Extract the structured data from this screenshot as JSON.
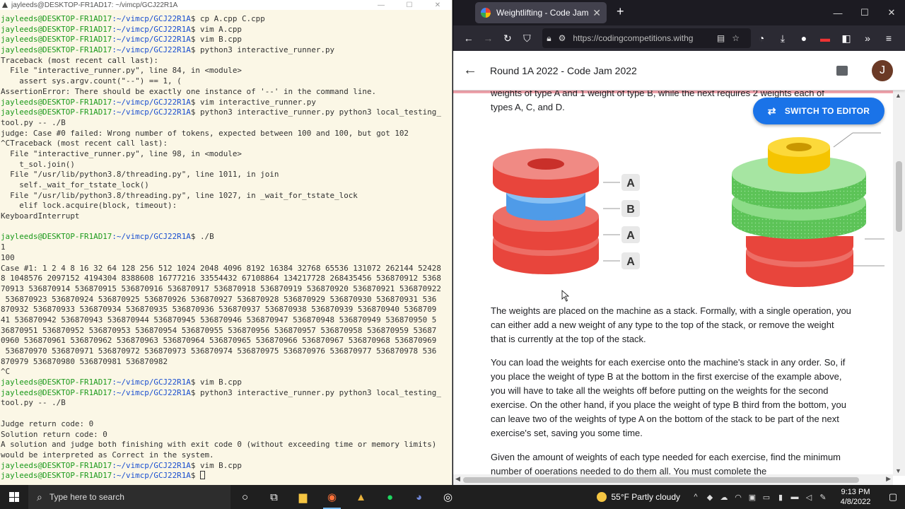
{
  "terminal": {
    "title": "jayleeds@DESKTOP-FR1AD17: ~/vimcp/GCJ22R1A",
    "lines": [
      {
        "u": "jayleeds@DESKTOP-FR1AD17",
        "p": ":~/vimcp/GCJ22R1A",
        "t": "$ cp A.cpp C.cpp"
      },
      {
        "u": "jayleeds@DESKTOP-FR1AD17",
        "p": ":~/vimcp/GCJ22R1A",
        "t": "$ vim A.cpp"
      },
      {
        "u": "jayleeds@DESKTOP-FR1AD17",
        "p": ":~/vimcp/GCJ22R1A",
        "t": "$ vim B.cpp"
      },
      {
        "u": "jayleeds@DESKTOP-FR1AD17",
        "p": ":~/vimcp/GCJ22R1A",
        "t": "$ python3 interactive_runner.py"
      },
      {
        "t": "Traceback (most recent call last):"
      },
      {
        "t": "  File \"interactive_runner.py\", line 84, in <module>"
      },
      {
        "t": "    assert sys.argv.count(\"--\") == 1, ("
      },
      {
        "t": "AssertionError: There should be exactly one instance of '--' in the command line."
      },
      {
        "u": "jayleeds@DESKTOP-FR1AD17",
        "p": ":~/vimcp/GCJ22R1A",
        "t": "$ vim interactive_runner.py"
      },
      {
        "u": "jayleeds@DESKTOP-FR1AD17",
        "p": ":~/vimcp/GCJ22R1A",
        "t": "$ python3 interactive_runner.py python3 local_testing_"
      },
      {
        "t": "tool.py -- ./B"
      },
      {
        "t": "judge: Case #0 failed: Wrong number of tokens, expected between 100 and 100, but got 102"
      },
      {
        "t": "^CTraceback (most recent call last):"
      },
      {
        "t": "  File \"interactive_runner.py\", line 98, in <module>"
      },
      {
        "t": "    t_sol.join()"
      },
      {
        "t": "  File \"/usr/lib/python3.8/threading.py\", line 1011, in join"
      },
      {
        "t": "    self._wait_for_tstate_lock()"
      },
      {
        "t": "  File \"/usr/lib/python3.8/threading.py\", line 1027, in _wait_for_tstate_lock"
      },
      {
        "t": "    elif lock.acquire(block, timeout):"
      },
      {
        "t": "KeyboardInterrupt"
      },
      {
        "t": ""
      },
      {
        "u": "jayleeds@DESKTOP-FR1AD17",
        "p": ":~/vimcp/GCJ22R1A",
        "t": "$ ./B"
      },
      {
        "t": "1"
      },
      {
        "t": "100"
      },
      {
        "t": "Case #1: 1 2 4 8 16 32 64 128 256 512 1024 2048 4096 8192 16384 32768 65536 131072 262144 52428"
      },
      {
        "t": "8 1048576 2097152 4194304 8388608 16777216 33554432 67108864 134217728 268435456 536870912 5368"
      },
      {
        "t": "70913 536870914 536870915 536870916 536870917 536870918 536870919 536870920 536870921 536870922"
      },
      {
        "t": " 536870923 536870924 536870925 536870926 536870927 536870928 536870929 536870930 536870931 536"
      },
      {
        "t": "870932 536870933 536870934 536870935 536870936 536870937 536870938 536870939 536870940 5368709"
      },
      {
        "t": "41 536870942 536870943 536870944 536870945 536870946 536870947 536870948 536870949 536870950 5"
      },
      {
        "t": "36870951 536870952 536870953 536870954 536870955 536870956 536870957 536870958 536870959 53687"
      },
      {
        "t": "0960 536870961 536870962 536870963 536870964 536870965 536870966 536870967 536870968 536870969"
      },
      {
        "t": " 536870970 536870971 536870972 536870973 536870974 536870975 536870976 536870977 536870978 536"
      },
      {
        "t": "870979 536870980 536870981 536870982"
      },
      {
        "t": "^C"
      },
      {
        "u": "jayleeds@DESKTOP-FR1AD17",
        "p": ":~/vimcp/GCJ22R1A",
        "t": "$ vim B.cpp"
      },
      {
        "u": "jayleeds@DESKTOP-FR1AD17",
        "p": ":~/vimcp/GCJ22R1A",
        "t": "$ python3 interactive_runner.py python3 local_testing_"
      },
      {
        "t": "tool.py -- ./B"
      },
      {
        "t": ""
      },
      {
        "t": "Judge return code: 0"
      },
      {
        "t": "Solution return code: 0"
      },
      {
        "t": "A solution and judge both finishing with exit code 0 (without exceeding time or memory limits)"
      },
      {
        "t": "would be interpreted as Correct in the system."
      },
      {
        "u": "jayleeds@DESKTOP-FR1AD17",
        "p": ":~/vimcp/GCJ22R1A",
        "t": "$ vim B.cpp"
      },
      {
        "u": "jayleeds@DESKTOP-FR1AD17",
        "p": ":~/vimcp/GCJ22R1A",
        "t": "$ ",
        "cursor": true
      }
    ]
  },
  "browser": {
    "tab_title": "Weightlifting - Code Jam",
    "url": "https://codingcompetitions.withg",
    "page_title": "Round 1A 2022 - Code Jam 2022",
    "avatar_letter": "J",
    "switch_button": "SWITCH TO EDITOR",
    "intro_line1": "weights of type A and 1 weight of type B, while the next requires 2 weights each of",
    "intro_line2": "types A, C, and D.",
    "stack_labels": [
      "A",
      "B",
      "A",
      "A"
    ],
    "para1": "The weights are placed on the machine as a stack. Formally, with a single operation, you can either add a new weight of any type to the top of the stack, or remove the weight that is currently at the top of the stack.",
    "para2": "You can load the weights for each exercise onto the machine's stack in any order. So, if you place the weight of type B at the bottom in the first exercise of the example above, you will have to take all the weights off before putting on the weights for the second exercise. On the other hand, if you place the weight of type B third from the bottom, you can leave two of the weights of type A on the bottom of the stack to be part of the next exercise's set, saving you some time.",
    "para3": "Given the amount of weights of each type needed for each exercise, find the minimum number of operations needed to do them all. You must complete the"
  },
  "taskbar": {
    "search_placeholder": "Type here to search",
    "weather": "55°F  Partly cloudy",
    "time": "9:13 PM",
    "date": "4/8/2022"
  }
}
